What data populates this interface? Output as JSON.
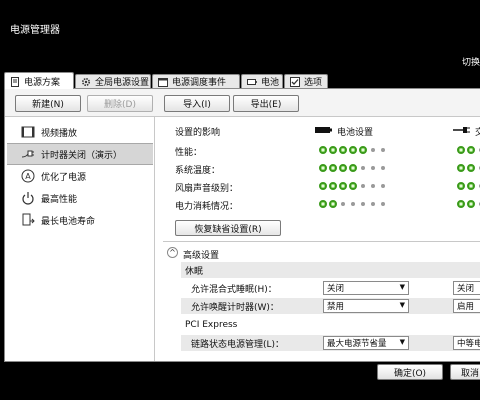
{
  "window": {
    "title": "电源管理器",
    "top_right_text": "切换"
  },
  "tabs": [
    {
      "label": "电源方案",
      "icon": "document-icon"
    },
    {
      "label": "全局电源设置",
      "icon": "gear-icon"
    },
    {
      "label": "电源调度事件",
      "icon": "calendar-icon"
    },
    {
      "label": "电池",
      "icon": "battery-icon"
    },
    {
      "label": "选项",
      "icon": "checkbox-icon"
    }
  ],
  "toolbar": {
    "new": "新建(N)",
    "delete": "删除(D)",
    "import": "导入(I)",
    "export": "导出(E)"
  },
  "plans": [
    {
      "label": "视频播放",
      "icon": "video-icon"
    },
    {
      "label": "计时器关闭（演示）",
      "icon": "plug-icon"
    },
    {
      "label": "优化了电源",
      "icon": "a-circle-icon"
    },
    {
      "label": "最高性能",
      "icon": "power-icon"
    },
    {
      "label": "最长电池寿命",
      "icon": "battery-extend-icon"
    }
  ],
  "settings": {
    "section_title": "设置的影响",
    "battery_col": "电池设置",
    "ac_col": "交",
    "ratings": [
      {
        "label": "性能：",
        "battery": 5,
        "ac": 2
      },
      {
        "label": "系统温度：",
        "battery": 4,
        "ac": 2
      },
      {
        "label": "风扇声音级别：",
        "battery": 4,
        "ac": 2
      },
      {
        "label": "电力消耗情况：",
        "battery": 2,
        "ac": 2
      }
    ],
    "max_dots": 7,
    "restore_button": "恢复缺省设置(R)"
  },
  "advanced": {
    "title": "高级设置",
    "groups": [
      {
        "title": "休眠",
        "rows": [
          {
            "label": "允许混合式睡眠(H)：",
            "battery": "关闭",
            "ac": "关闭"
          },
          {
            "label": "允许唤醒计时器(W)：",
            "battery": "禁用",
            "ac": "启用"
          }
        ]
      },
      {
        "title": "PCI Express",
        "rows": [
          {
            "label": "链路状态电源管理(L)：",
            "battery": "最大电源节省量",
            "ac": "中等电源"
          }
        ]
      }
    ]
  },
  "footer": {
    "ok": "确定(O)",
    "cancel": "取消"
  }
}
